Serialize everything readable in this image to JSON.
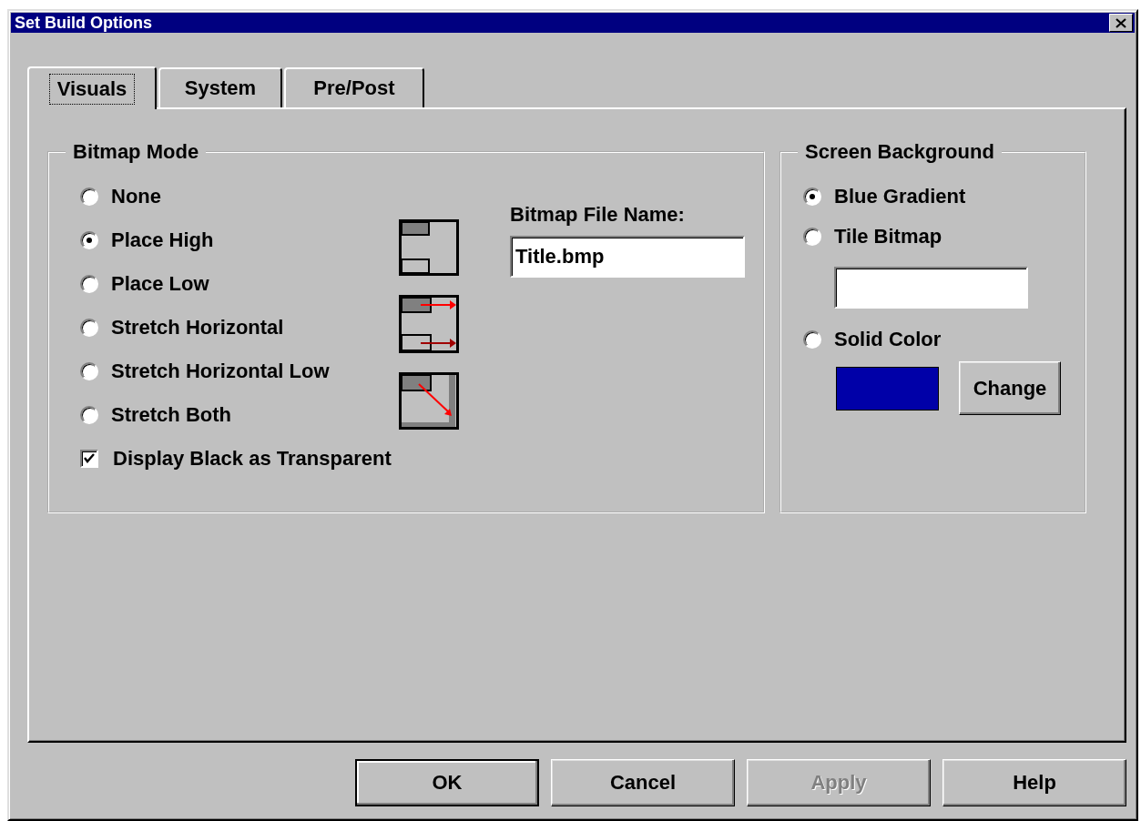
{
  "window": {
    "title": "Set Build Options"
  },
  "tabs": [
    {
      "label": "Visuals",
      "selected": true
    },
    {
      "label": "System",
      "selected": false
    },
    {
      "label": "Pre/Post",
      "selected": false
    }
  ],
  "bitmap_mode": {
    "title": "Bitmap Mode",
    "options": [
      {
        "label": "None",
        "selected": false
      },
      {
        "label": "Place High",
        "selected": true
      },
      {
        "label": "Place Low",
        "selected": false
      },
      {
        "label": "Stretch Horizontal",
        "selected": false
      },
      {
        "label": "Stretch Horizontal Low",
        "selected": false
      },
      {
        "label": "Stretch Both",
        "selected": false
      }
    ],
    "transparent_black": {
      "label": "Display Black as Transparent",
      "checked": true
    },
    "file_name": {
      "label": "Bitmap File Name:",
      "value": "Title.bmp"
    }
  },
  "screen_background": {
    "title": "Screen Background",
    "options": [
      {
        "label": "Blue Gradient",
        "selected": true
      },
      {
        "label": "Tile Bitmap",
        "selected": false
      },
      {
        "label": "Solid Color",
        "selected": false
      }
    ],
    "swatch": {
      "color": "#0000a8"
    },
    "change_button": "Change"
  },
  "buttons": [
    {
      "label": "OK",
      "default": true,
      "disabled": false
    },
    {
      "label": "Cancel",
      "default": false,
      "disabled": false
    },
    {
      "label": "Apply",
      "default": false,
      "disabled": true
    },
    {
      "label": "Help",
      "default": false,
      "disabled": false
    }
  ]
}
